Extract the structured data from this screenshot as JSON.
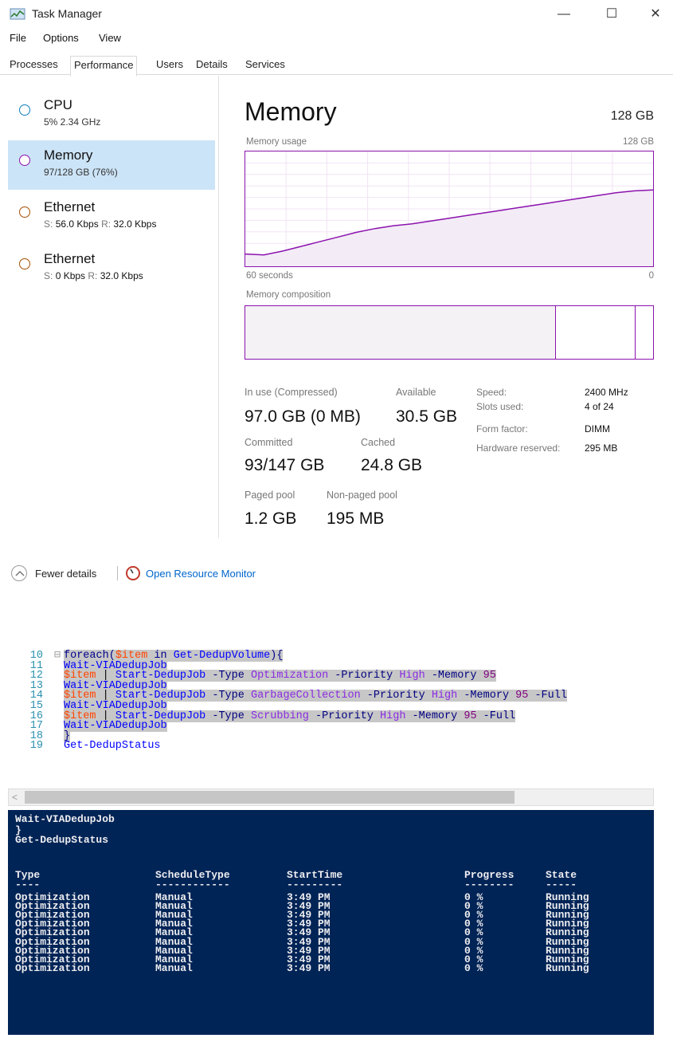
{
  "window": {
    "title": "Task Manager",
    "minimize": "—",
    "maximize": "☐",
    "close": "✕"
  },
  "menu": [
    "File",
    "Options",
    "View"
  ],
  "tabs": [
    "Processes",
    "Performance",
    "Users",
    "Details",
    "Services"
  ],
  "resources": [
    {
      "name": "CPU",
      "sub": "5% 2.34 GHz",
      "color": "#117dbb"
    },
    {
      "name": "Memory",
      "sub": "97/128 GB (76%)",
      "color": "#8b12ae"
    },
    {
      "name": "Ethernet",
      "send_label": "S:",
      "send": "56.0 Kbps",
      "recv_label": "R:",
      "recv": "32.0 Kbps",
      "color": "#a74f01"
    },
    {
      "name": "Ethernet",
      "send_label": "S:",
      "send": "0 Kbps",
      "recv_label": "R:",
      "recv": "32.0 Kbps",
      "color": "#a74f01"
    }
  ],
  "memory": {
    "title": "Memory",
    "total": "128 GB",
    "usage_label": "Memory usage",
    "usage_max": "128 GB",
    "time_left": "60 seconds",
    "time_right": "0",
    "composition_label": "Memory composition",
    "usage_history_pct": [
      0.08,
      0.07,
      0.11,
      0.16,
      0.21,
      0.26,
      0.31,
      0.35,
      0.38,
      0.4,
      0.43,
      0.46,
      0.49,
      0.52,
      0.55,
      0.58,
      0.61,
      0.64,
      0.67,
      0.7,
      0.73,
      0.75,
      0.76
    ],
    "stats": {
      "in_use_label": "In use (Compressed)",
      "in_use": "97.0 GB (0 MB)",
      "available_label": "Available",
      "available": "30.5 GB",
      "committed_label": "Committed",
      "committed": "93/147 GB",
      "cached_label": "Cached",
      "cached": "24.8 GB",
      "paged_label": "Paged pool",
      "paged": "1.2 GB",
      "nonpaged_label": "Non-paged pool",
      "nonpaged": "195 MB"
    },
    "specs": [
      {
        "label": "Speed:",
        "value": "2400 MHz"
      },
      {
        "label": "Slots used:",
        "value": "4 of 24"
      },
      {
        "label": "Form factor:",
        "value": "DIMM"
      },
      {
        "label": "Hardware reserved:",
        "value": "295 MB"
      }
    ]
  },
  "footer": {
    "fewer_details": "Fewer details",
    "open_resource_monitor": "Open Resource Monitor"
  },
  "editor": {
    "lines": [
      {
        "n": "10",
        "fold": "⊟",
        "tokens": [
          [
            "foreach(",
            "k-blue"
          ],
          [
            "$item",
            "k-var"
          ],
          [
            " in ",
            "k-blue"
          ],
          [
            "Get-DedupVolume",
            "k-cmd"
          ],
          [
            "){",
            "k-blue"
          ]
        ]
      },
      {
        "n": "11",
        "fold": "",
        "tokens": [
          [
            "Wait-VIADedupJob",
            "k-cmd"
          ]
        ]
      },
      {
        "n": "12",
        "fold": "",
        "tokens": [
          [
            "$item",
            "k-var"
          ],
          [
            " | ",
            "k-plain"
          ],
          [
            "Start-DedupJob",
            "k-cmd"
          ],
          [
            " -Type ",
            "k-par"
          ],
          [
            "Optimization",
            "k-str"
          ],
          [
            " -Priority ",
            "k-par"
          ],
          [
            "High",
            "k-str"
          ],
          [
            " -Memory ",
            "k-par"
          ],
          [
            "95",
            "k-num"
          ]
        ]
      },
      {
        "n": "13",
        "fold": "",
        "tokens": [
          [
            "Wait-VIADedupJob",
            "k-cmd"
          ]
        ]
      },
      {
        "n": "14",
        "fold": "",
        "tokens": [
          [
            "$item",
            "k-var"
          ],
          [
            " | ",
            "k-plain"
          ],
          [
            "Start-DedupJob",
            "k-cmd"
          ],
          [
            " -Type ",
            "k-par"
          ],
          [
            "GarbageCollection",
            "k-str"
          ],
          [
            " -Priority ",
            "k-par"
          ],
          [
            "High",
            "k-str"
          ],
          [
            " -Memory ",
            "k-par"
          ],
          [
            "95",
            "k-num"
          ],
          [
            " -Full",
            "k-par"
          ]
        ]
      },
      {
        "n": "15",
        "fold": "",
        "tokens": [
          [
            "Wait-VIADedupJob",
            "k-cmd"
          ]
        ]
      },
      {
        "n": "16",
        "fold": "",
        "tokens": [
          [
            "$item",
            "k-var"
          ],
          [
            " | ",
            "k-plain"
          ],
          [
            "Start-DedupJob",
            "k-cmd"
          ],
          [
            " -Type ",
            "k-par"
          ],
          [
            "Scrubbing",
            "k-str"
          ],
          [
            " -Priority ",
            "k-par"
          ],
          [
            "High",
            "k-str"
          ],
          [
            " -Memory ",
            "k-par"
          ],
          [
            "95",
            "k-num"
          ],
          [
            " -Full",
            "k-par"
          ]
        ]
      },
      {
        "n": "17",
        "fold": "",
        "tokens": [
          [
            "Wait-VIADedupJob",
            "k-cmd"
          ]
        ]
      },
      {
        "n": "18",
        "fold": "",
        "tokens": [
          [
            "}",
            "k-blue"
          ]
        ]
      },
      {
        "n": "19",
        "fold": "",
        "tokens": [
          [
            "Get-DedupStatus",
            "k-cmd"
          ]
        ]
      }
    ],
    "scroll_left": "<"
  },
  "console": {
    "echo": [
      "Wait-VIADedupJob",
      "}",
      "Get-DedupStatus"
    ],
    "headers": [
      "Type",
      "ScheduleType",
      "StartTime",
      "Progress",
      "State"
    ],
    "underlines": [
      "----",
      "------------",
      "---------",
      "--------",
      "-----"
    ],
    "rows": [
      [
        "Optimization",
        "Manual",
        "3:49 PM",
        "0 %",
        "Running"
      ],
      [
        "Optimization",
        "Manual",
        "3:49 PM",
        "0 %",
        "Running"
      ],
      [
        "Optimization",
        "Manual",
        "3:49 PM",
        "0 %",
        "Running"
      ],
      [
        "Optimization",
        "Manual",
        "3:49 PM",
        "0 %",
        "Running"
      ],
      [
        "Optimization",
        "Manual",
        "3:49 PM",
        "0 %",
        "Running"
      ],
      [
        "Optimization",
        "Manual",
        "3:49 PM",
        "0 %",
        "Running"
      ],
      [
        "Optimization",
        "Manual",
        "3:49 PM",
        "0 %",
        "Running"
      ],
      [
        "Optimization",
        "Manual",
        "3:49 PM",
        "0 %",
        "Running"
      ],
      [
        "Optimization",
        "Manual",
        "3:49 PM",
        "0 %",
        "Running"
      ]
    ]
  }
}
